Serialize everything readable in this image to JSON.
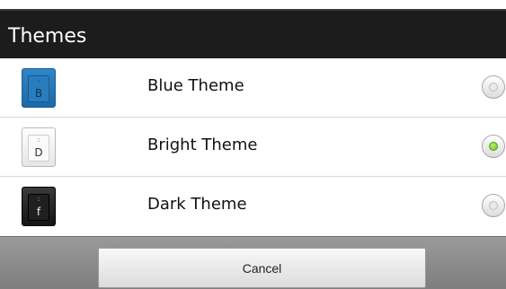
{
  "dialog": {
    "title": "Themes",
    "themes": [
      {
        "label": "Blue Theme",
        "key_char": "B",
        "key_top": "–",
        "selected": false
      },
      {
        "label": "Bright Theme",
        "key_char": "D",
        "key_top": ":",
        "selected": true
      },
      {
        "label": "Dark Theme",
        "key_char": "f",
        "key_top": ":",
        "selected": false
      }
    ],
    "cancel_label": "Cancel"
  },
  "colors": {
    "radio_selected": "#68c61c",
    "title_bar": "#1c1c1c"
  }
}
